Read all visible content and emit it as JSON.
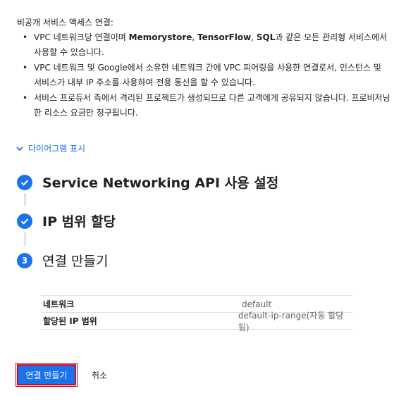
{
  "intro": {
    "heading": "비공개 서비스 액세스 연결:",
    "bullet1": {
      "pre": "VPC 네트워크당 연결이며 ",
      "b1": "Memorystore",
      "sep1": ", ",
      "b2": "TensorFlow",
      "sep2": ", ",
      "b3": "SQL",
      "post": "과 같은 모든 관리형 서비스에서 사용할 수 있습니다."
    },
    "bullet2": "VPC 네트워크 및 Google에서 소유한 네트워크 간에 VPC 피어링을 사용한 연결로서, 인스턴스 및 서비스가 내부 IP 주소를 사용하여 전용 통신을 할 수 있습니다.",
    "bullet3": "서비스 프로듀서 측에서 격리된 프로젝트가 생성되므로 다른 고객에게 공유되지 않습니다. 프로비저닝한 리소스 요금만 청구됩니다."
  },
  "diagram_toggle": {
    "label": "다이어그램 표시",
    "icon": "chevron-down-icon"
  },
  "steps": [
    {
      "title": "Service Networking API 사용 설정",
      "status": "done",
      "icon": "check-icon"
    },
    {
      "title": "IP 범위 할당",
      "status": "done",
      "icon": "check-icon"
    },
    {
      "number": "3",
      "title": "연결 만들기",
      "status": "current"
    }
  ],
  "details": [
    {
      "key": "네트워크",
      "value": "default"
    },
    {
      "key": "할당된 IP 범위",
      "value": "default-ip-range(자동 할당됨)"
    }
  ],
  "actions": {
    "create_label": "연결 만들기",
    "cancel_label": "취소"
  },
  "colors": {
    "accent": "#1a73e8",
    "highlight": "#e0001b"
  }
}
